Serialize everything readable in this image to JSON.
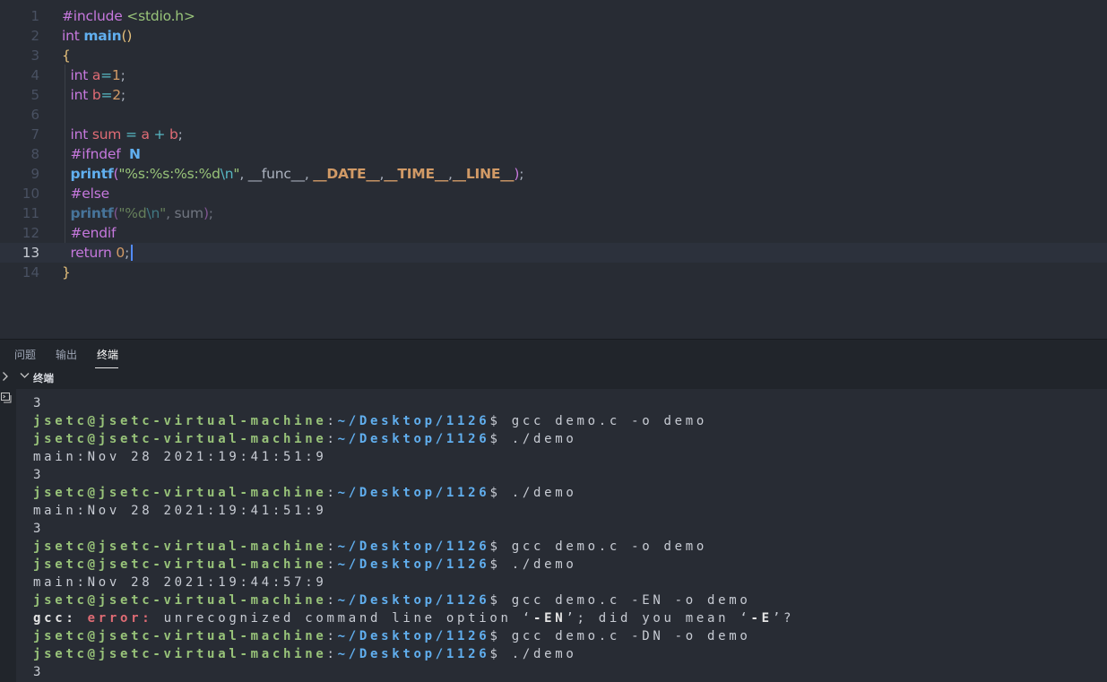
{
  "editor": {
    "current_line": 13,
    "lines": [
      {
        "n": "1",
        "tokens": [
          {
            "t": "#include",
            "c": "kw"
          },
          {
            "t": " ",
            "c": "pun"
          },
          {
            "t": "<stdio.h>",
            "c": "inc"
          }
        ]
      },
      {
        "n": "2",
        "tokens": [
          {
            "t": "int",
            "c": "kw"
          },
          {
            "t": " ",
            "c": "pun"
          },
          {
            "t": "main",
            "c": "fnb"
          },
          {
            "t": "()",
            "c": "br1"
          }
        ]
      },
      {
        "n": "3",
        "tokens": [
          {
            "t": "{",
            "c": "br1"
          }
        ]
      },
      {
        "n": "4",
        "tokens": [
          {
            "t": "  ",
            "c": "pun"
          },
          {
            "t": "int",
            "c": "kw"
          },
          {
            "t": " ",
            "c": "pun"
          },
          {
            "t": "a",
            "c": "var"
          },
          {
            "t": "=",
            "c": "op"
          },
          {
            "t": "1",
            "c": "num"
          },
          {
            "t": ";",
            "c": "pun"
          }
        ]
      },
      {
        "n": "5",
        "tokens": [
          {
            "t": "  ",
            "c": "pun"
          },
          {
            "t": "int",
            "c": "kw"
          },
          {
            "t": " ",
            "c": "pun"
          },
          {
            "t": "b",
            "c": "var"
          },
          {
            "t": "=",
            "c": "op"
          },
          {
            "t": "2",
            "c": "num"
          },
          {
            "t": ";",
            "c": "pun"
          }
        ]
      },
      {
        "n": "6",
        "tokens": []
      },
      {
        "n": "7",
        "tokens": [
          {
            "t": "  ",
            "c": "pun"
          },
          {
            "t": "int",
            "c": "kw"
          },
          {
            "t": " ",
            "c": "pun"
          },
          {
            "t": "sum",
            "c": "var"
          },
          {
            "t": " = ",
            "c": "op"
          },
          {
            "t": "a",
            "c": "var"
          },
          {
            "t": " + ",
            "c": "op"
          },
          {
            "t": "b",
            "c": "var"
          },
          {
            "t": ";",
            "c": "pun"
          }
        ]
      },
      {
        "n": "8",
        "tokens": [
          {
            "t": "  ",
            "c": "pun"
          },
          {
            "t": "#ifndef",
            "c": "kw"
          },
          {
            "t": "  ",
            "c": "pun"
          },
          {
            "t": "N",
            "c": "fnb"
          }
        ]
      },
      {
        "n": "9",
        "tokens": [
          {
            "t": "  ",
            "c": "pun"
          },
          {
            "t": "printf",
            "c": "fnb"
          },
          {
            "t": "(",
            "c": "br2"
          },
          {
            "t": "\"%s:%s:%s:%d",
            "c": "str"
          },
          {
            "t": "\\n",
            "c": "esc"
          },
          {
            "t": "\"",
            "c": "str"
          },
          {
            "t": ", __func__, ",
            "c": "pun"
          },
          {
            "t": "__DATE__",
            "c": "mac"
          },
          {
            "t": ",",
            "c": "pun"
          },
          {
            "t": "__TIME__",
            "c": "mac"
          },
          {
            "t": ",",
            "c": "pun"
          },
          {
            "t": "__LINE__",
            "c": "mac"
          },
          {
            "t": ")",
            "c": "br2"
          },
          {
            "t": ";",
            "c": "pun"
          }
        ]
      },
      {
        "n": "10",
        "tokens": [
          {
            "t": "  ",
            "c": "pun"
          },
          {
            "t": "#else",
            "c": "kw"
          }
        ]
      },
      {
        "n": "11",
        "dim": true,
        "tokens": [
          {
            "t": "  ",
            "c": "pun"
          },
          {
            "t": "printf",
            "c": "fnb"
          },
          {
            "t": "(",
            "c": "br2"
          },
          {
            "t": "\"%d",
            "c": "str"
          },
          {
            "t": "\\n",
            "c": "esc"
          },
          {
            "t": "\"",
            "c": "str"
          },
          {
            "t": ", sum",
            "c": "pun"
          },
          {
            "t": ")",
            "c": "br2"
          },
          {
            "t": ";",
            "c": "pun"
          }
        ]
      },
      {
        "n": "12",
        "tokens": [
          {
            "t": "  ",
            "c": "pun"
          },
          {
            "t": "#endif",
            "c": "kw"
          }
        ]
      },
      {
        "n": "13",
        "tokens": [
          {
            "t": "  ",
            "c": "pun"
          },
          {
            "t": "return",
            "c": "kw"
          },
          {
            "t": " ",
            "c": "pun"
          },
          {
            "t": "0",
            "c": "num"
          },
          {
            "t": ";",
            "c": "pun"
          }
        ]
      },
      {
        "n": "14",
        "tokens": [
          {
            "t": "}",
            "c": "br1"
          }
        ]
      }
    ]
  },
  "panel": {
    "tabs": [
      {
        "label": "问题",
        "active": false
      },
      {
        "label": "输出",
        "active": false
      },
      {
        "label": "终端",
        "active": true
      }
    ],
    "section_title": "终端"
  },
  "terminal": {
    "lines": [
      [
        {
          "t": "3",
          "c": "t-plain"
        }
      ],
      [
        {
          "t": "jsetc@jsetc-virtual-machine",
          "c": "t-user"
        },
        {
          "t": ":",
          "c": "t-plain"
        },
        {
          "t": "~/Desktop/1126",
          "c": "t-path"
        },
        {
          "t": "$ gcc demo.c -o demo",
          "c": "t-plain"
        }
      ],
      [
        {
          "t": "jsetc@jsetc-virtual-machine",
          "c": "t-user"
        },
        {
          "t": ":",
          "c": "t-plain"
        },
        {
          "t": "~/Desktop/1126",
          "c": "t-path"
        },
        {
          "t": "$ ./demo",
          "c": "t-plain"
        }
      ],
      [
        {
          "t": "main:Nov 28 2021:19:41:51:9",
          "c": "t-plain"
        }
      ],
      [
        {
          "t": "3",
          "c": "t-plain"
        }
      ],
      [
        {
          "t": "jsetc@jsetc-virtual-machine",
          "c": "t-user"
        },
        {
          "t": ":",
          "c": "t-plain"
        },
        {
          "t": "~/Desktop/1126",
          "c": "t-path"
        },
        {
          "t": "$ ./demo",
          "c": "t-plain"
        }
      ],
      [
        {
          "t": "main:Nov 28 2021:19:41:51:9",
          "c": "t-plain"
        }
      ],
      [
        {
          "t": "3",
          "c": "t-plain"
        }
      ],
      [
        {
          "t": "jsetc@jsetc-virtual-machine",
          "c": "t-user"
        },
        {
          "t": ":",
          "c": "t-plain"
        },
        {
          "t": "~/Desktop/1126",
          "c": "t-path"
        },
        {
          "t": "$ gcc demo.c -o demo",
          "c": "t-plain"
        }
      ],
      [
        {
          "t": "jsetc@jsetc-virtual-machine",
          "c": "t-user"
        },
        {
          "t": ":",
          "c": "t-plain"
        },
        {
          "t": "~/Desktop/1126",
          "c": "t-path"
        },
        {
          "t": "$ ./demo",
          "c": "t-plain"
        }
      ],
      [
        {
          "t": "main:Nov 28 2021:19:44:57:9",
          "c": "t-plain"
        }
      ],
      [
        {
          "t": "jsetc@jsetc-virtual-machine",
          "c": "t-user"
        },
        {
          "t": ":",
          "c": "t-plain"
        },
        {
          "t": "~/Desktop/1126",
          "c": "t-path"
        },
        {
          "t": "$ gcc demo.c -EN -o demo",
          "c": "t-plain"
        }
      ],
      [
        {
          "t": "gcc: ",
          "c": "t-bold"
        },
        {
          "t": "error: ",
          "c": "t-err"
        },
        {
          "t": "unrecognized command line option ‘",
          "c": "t-plain"
        },
        {
          "t": "-EN",
          "c": "t-bold"
        },
        {
          "t": "’; did you mean ‘",
          "c": "t-plain"
        },
        {
          "t": "-E",
          "c": "t-bold"
        },
        {
          "t": "’?",
          "c": "t-plain"
        }
      ],
      [
        {
          "t": "jsetc@jsetc-virtual-machine",
          "c": "t-user"
        },
        {
          "t": ":",
          "c": "t-plain"
        },
        {
          "t": "~/Desktop/1126",
          "c": "t-path"
        },
        {
          "t": "$ gcc demo.c -DN -o demo",
          "c": "t-plain"
        }
      ],
      [
        {
          "t": "jsetc@jsetc-virtual-machine",
          "c": "t-user"
        },
        {
          "t": ":",
          "c": "t-plain"
        },
        {
          "t": "~/Desktop/1126",
          "c": "t-path"
        },
        {
          "t": "$ ./demo",
          "c": "t-plain"
        }
      ],
      [
        {
          "t": "3",
          "c": "t-plain"
        }
      ]
    ]
  },
  "colors": {
    "editor_bg": "#282c34",
    "panel_bg": "#21252b",
    "keyword": "#c678dd",
    "function": "#61afef",
    "string": "#98c379",
    "number": "#d19a66",
    "variable": "#e06c75",
    "terminal_user": "#98c379",
    "terminal_path": "#61afef",
    "terminal_error": "#e06c75"
  }
}
